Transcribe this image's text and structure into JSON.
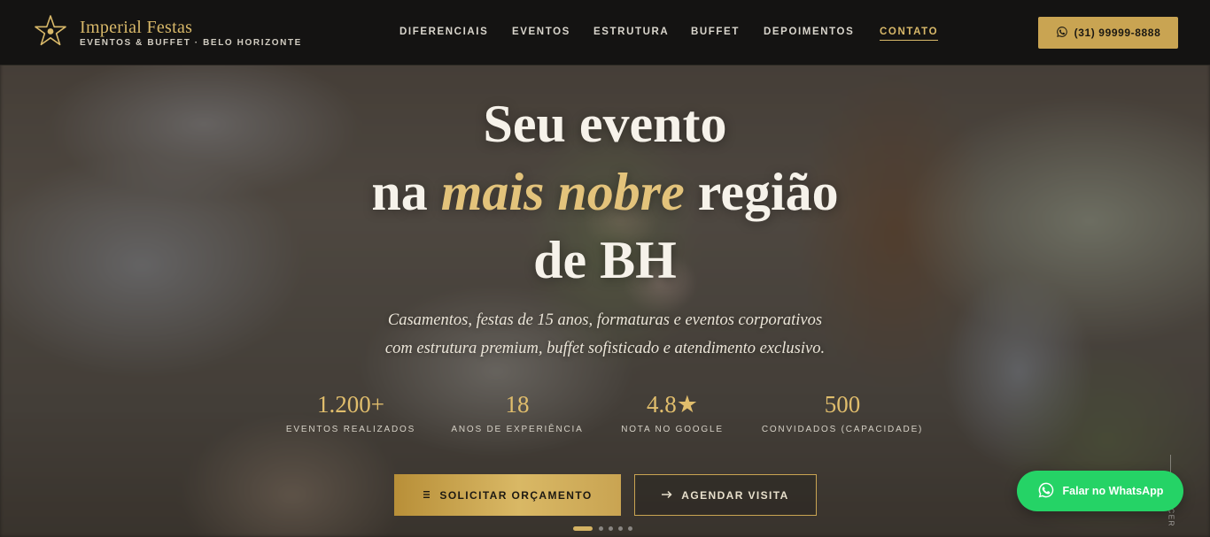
{
  "brand": {
    "name": "Imperial Festas",
    "tagline": "EVENTOS & BUFFET · BELO HORIZONTE",
    "logo_icon": "star-icon"
  },
  "nav": {
    "items": [
      {
        "label": "DIFERENCIAIS",
        "active": false
      },
      {
        "label": "EVENTOS",
        "active": false
      },
      {
        "label": "ESTRUTURA",
        "active": false
      },
      {
        "label": "BUFFET",
        "active": false
      },
      {
        "label": "DEPOIMENTOS",
        "active": false
      },
      {
        "label": "CONTATO",
        "active": true
      }
    ]
  },
  "header": {
    "phone_label": "(31) 99999-8888",
    "phone_icon": "whatsapp-icon"
  },
  "hero": {
    "headline_line1": "Seu evento",
    "headline_pre": "na ",
    "headline_accent": "mais nobre",
    "headline_post": " região",
    "headline_line3": "de BH",
    "subtitle_line1": "Casamentos, festas de 15 anos, formaturas e eventos corporativos",
    "subtitle_line2": "com estrutura premium, buffet sofisticado e atendimento exclusivo."
  },
  "stats": [
    {
      "value": "1.200+",
      "label": "EVENTOS REALIZADOS"
    },
    {
      "value": "18",
      "label": "ANOS DE EXPERIÊNCIA"
    },
    {
      "value": "4.8★",
      "label": "NOTA NO GOOGLE"
    },
    {
      "value": "500",
      "label": "CONVIDADOS (CAPACIDADE)"
    }
  ],
  "cta": {
    "primary_label": "SOLICITAR ORÇAMENTO",
    "primary_icon": "menu-icon",
    "secondary_label": "AGENDAR VISITA",
    "secondary_icon": "arrow-right-icon"
  },
  "slider": {
    "count": 5,
    "active_index": 0
  },
  "whatsapp": {
    "label": "Falar no WhatsApp",
    "icon": "whatsapp-icon"
  },
  "scroll_hint": {
    "label": "CER"
  },
  "colors": {
    "gold": "#c9a452",
    "gold_text": "#d8b869",
    "header_bg": "#141312",
    "whatsapp_green": "#25d366"
  }
}
